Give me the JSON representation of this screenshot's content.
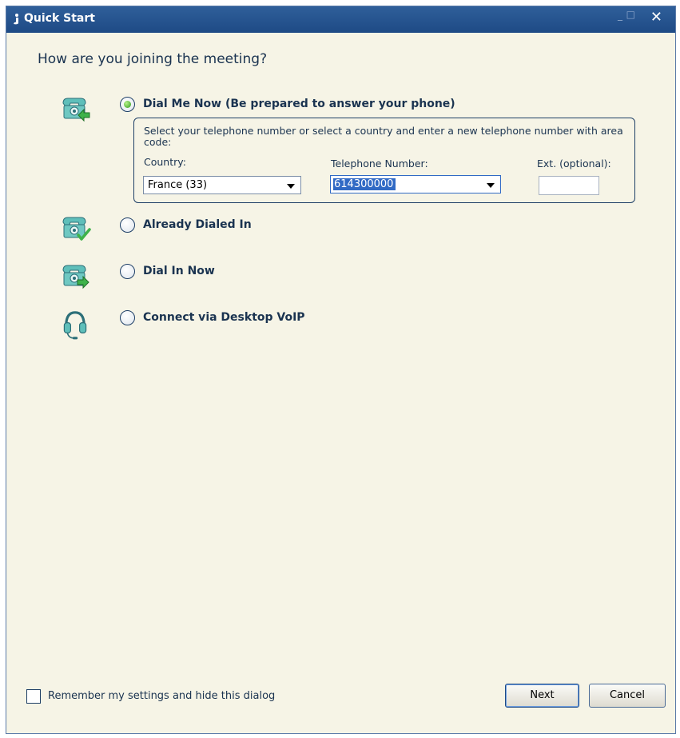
{
  "window": {
    "title": "Quick Start"
  },
  "heading": "How are you joining the meeting?",
  "options": [
    {
      "label": "Dial Me Now (Be prepared to answer your phone)",
      "icon": "phone-incoming-icon",
      "selected": true
    },
    {
      "label": "Already Dialed In",
      "icon": "phone-check-icon",
      "selected": false
    },
    {
      "label": "Dial In Now",
      "icon": "phone-outgoing-icon",
      "selected": false
    },
    {
      "label": "Connect via Desktop VoIP",
      "icon": "headset-icon",
      "selected": false
    }
  ],
  "dial_me": {
    "instruction": "Select your telephone number or select a country and enter a new telephone number with area code:",
    "country_label": "Country:",
    "country_value": "France (33)",
    "phone_label": "Telephone Number:",
    "phone_value": "614300000",
    "ext_label": "Ext. (optional):",
    "ext_value": ""
  },
  "footer": {
    "remember_label": "Remember my settings and hide this dialog",
    "remember_checked": false,
    "next_label": "Next",
    "cancel_label": "Cancel"
  },
  "colors": {
    "titlebar": "#2f5f9a",
    "background": "#f6f4e6",
    "text": "#1a3350",
    "selection": "#316ac5",
    "icon_teal": "#5fbfba",
    "arrow_green": "#3fb24a"
  }
}
